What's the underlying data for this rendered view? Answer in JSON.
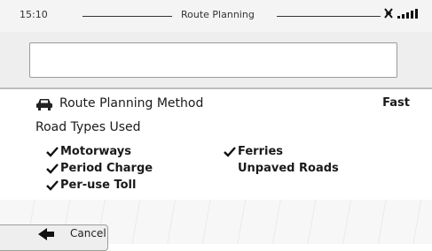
{
  "status_bar": {
    "time": "15:10",
    "title": "Route Planning"
  },
  "search": {
    "value": "",
    "placeholder": ""
  },
  "route_method": {
    "label": "Route Planning Method",
    "value": "Fast"
  },
  "road_types": {
    "title": "Road Types Used",
    "items": [
      {
        "label": "Motorways",
        "checked": true
      },
      {
        "label": "Period Charge",
        "checked": true
      },
      {
        "label": "Per-use Toll",
        "checked": true
      },
      {
        "label": "Ferries",
        "checked": true
      },
      {
        "label": "Unpaved Roads",
        "checked": false
      }
    ]
  },
  "footer": {
    "cancel_label": "Cancel"
  }
}
